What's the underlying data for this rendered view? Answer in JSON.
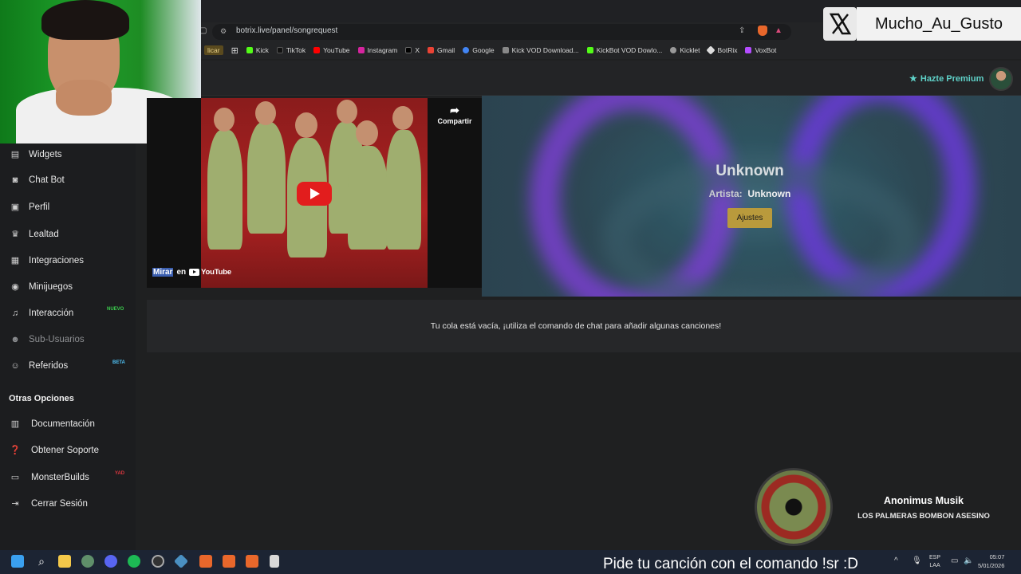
{
  "browser": {
    "url": "botrix.live/panel/songrequest",
    "bookmarks": [
      "licar",
      "Kick",
      "TikTok",
      "YouTube",
      "Instagram",
      "X",
      "Gmail",
      "Google",
      "Kick VOD Download...",
      "KickBot VOD Dowlo...",
      "Kicklet",
      "BotRix",
      "VoxBot"
    ]
  },
  "header": {
    "premium_label": "Hazte Premium"
  },
  "sidebar": {
    "items": [
      {
        "label": "Widgets",
        "icon": "table-icon"
      },
      {
        "label": "Chat Bot",
        "icon": "robot-icon"
      },
      {
        "label": "Perfil",
        "icon": "id-card-icon"
      },
      {
        "label": "Lealtad",
        "icon": "trophy-icon"
      },
      {
        "label": "Integraciones",
        "icon": "plug-icon"
      },
      {
        "label": "Minijuegos",
        "icon": "gamepad-icon"
      },
      {
        "label": "Interacción",
        "icon": "music-icon",
        "badge": "NUEVO"
      },
      {
        "label": "Sub-Usuarios",
        "icon": "users-icon"
      },
      {
        "label": "Referidos",
        "icon": "user-group-icon",
        "badge": "BETA"
      }
    ],
    "section_title": "Otras Opciones",
    "other_items": [
      {
        "label": "Documentación",
        "icon": "book-icon"
      },
      {
        "label": "Obtener Soporte",
        "icon": "help-icon"
      },
      {
        "label": "MonsterBuilds",
        "icon": "laptop-icon",
        "badge": "YAD"
      },
      {
        "label": "Cerrar Sesión",
        "icon": "logout-icon"
      }
    ]
  },
  "player": {
    "share_label": "Compartir",
    "watch_label": "Mirar",
    "watch_suffix": "en",
    "yt_label": "YouTube"
  },
  "song": {
    "title": "Unknown",
    "artist_label": "Artista:",
    "artist_value": "Unknown",
    "settings_button": "Ajustes"
  },
  "queue": {
    "empty_text": "Tu cola está vacía, ¡utiliza el comando de chat para añadir algunas canciones!"
  },
  "now_playing": {
    "artist": "Anonimus Musik",
    "song": "LOS PALMERAS BOMBON ASESINO"
  },
  "overlay": {
    "x_username": "Mucho_Au_Gusto"
  },
  "taskbar": {
    "promo_text": "Pide tu canción con el comando !sr :D",
    "lang_top": "ESP",
    "lang_bottom": "LAA",
    "time": "05:07",
    "date": "5/01/2026"
  },
  "colors": {
    "accent": "#5fd1c8",
    "button": "#b99a3c",
    "badge_new": "#3ccf4e",
    "badge_beta": "#4fc3f7"
  }
}
